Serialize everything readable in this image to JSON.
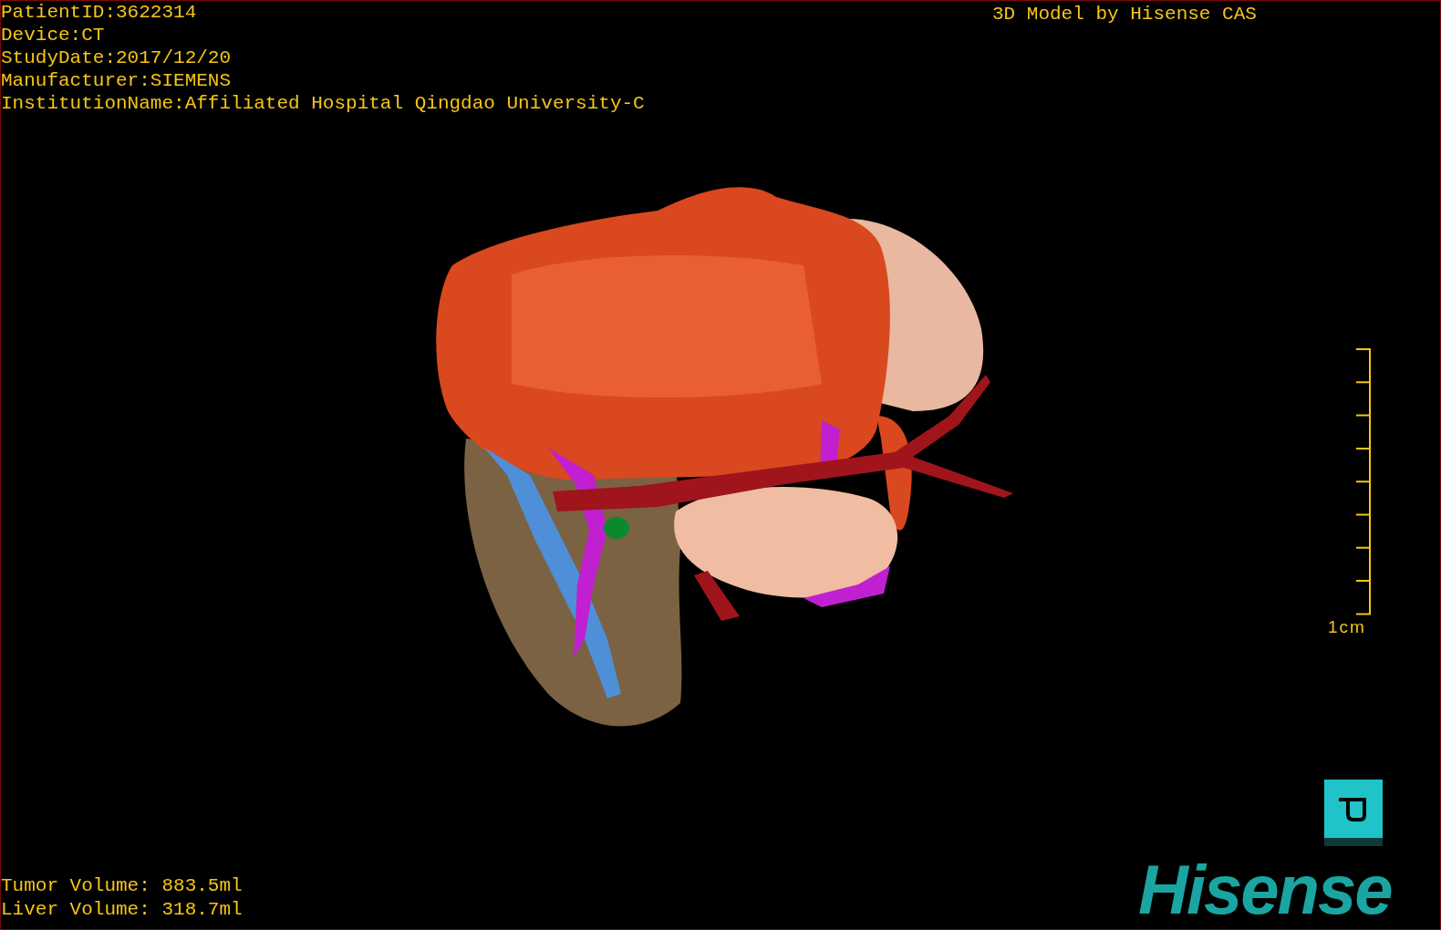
{
  "patient_info": [
    "PatientID:3622314",
    "Device:CT",
    "StudyDate:2017/12/20",
    "Manufacturer:SIEMENS",
    "InstitutionName:Affiliated Hospital Qingdao University-C"
  ],
  "credit": "3D Model by Hisense CAS",
  "scale_bar": {
    "label": "1cm"
  },
  "volumes": [
    "Tumor Volume: 883.5ml",
    "Liver Volume: 318.7ml"
  ],
  "logo": {
    "text": "Hisense"
  }
}
